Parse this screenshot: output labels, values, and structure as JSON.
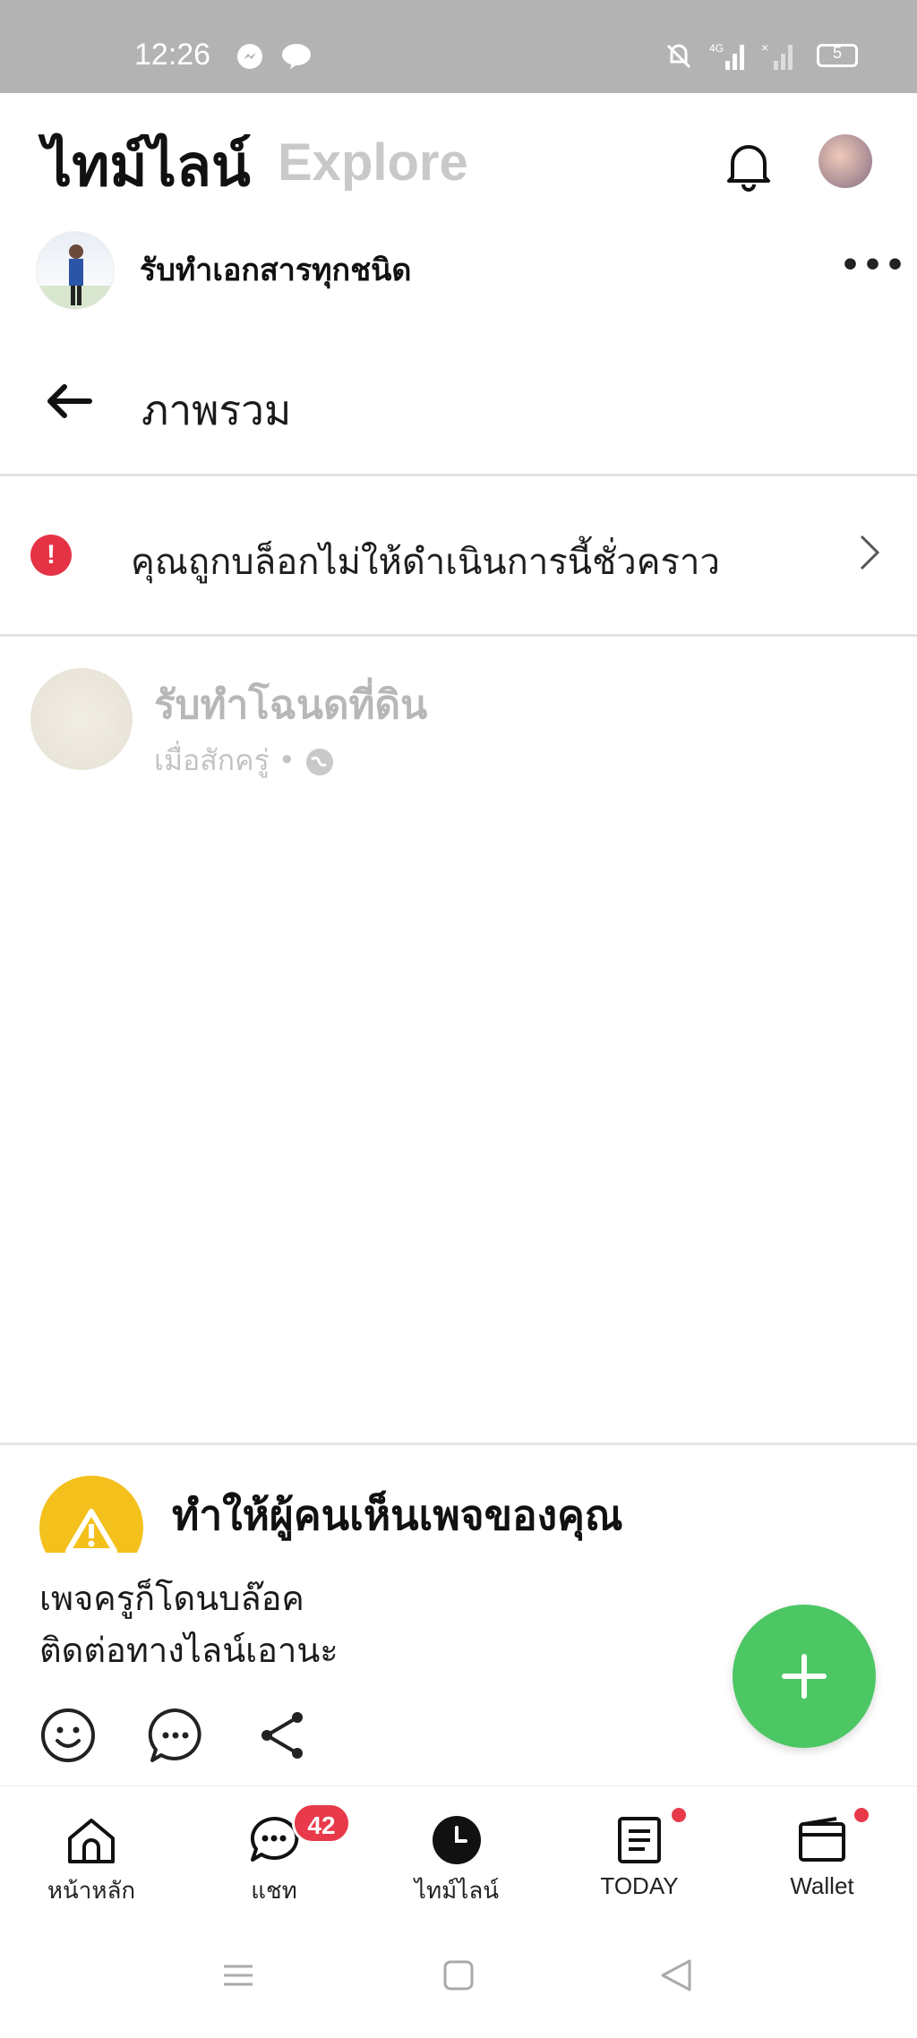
{
  "status_bar": {
    "time": "12:26",
    "network": "4G",
    "battery": "5",
    "bg_color": "#b3b3b3"
  },
  "header": {
    "title": "ไทม์ไลน์",
    "explore": "Explore",
    "bell_icon": "bell-icon"
  },
  "post": {
    "author": "รับทำเอกสารทุกชนิด",
    "embed": {
      "overview_label": "ภาพรวม",
      "blocked_message": "คุณถูกบล็อกไม่ให้ดำเนินการนี้ชั่วคราว",
      "faded_title": "รับทำโฉนดที่ดิน",
      "faded_sub": "เมื่อสักครู่ •"
    },
    "promo_title": "ทำให้ผู้คนเห็นเพจของคุณ",
    "caption_line1": "เพจครูก็โดนบล๊อค",
    "caption_line2": "ติดต่อทางไลน์เอานะ"
  },
  "tabs": [
    {
      "label": "หน้าหลัก",
      "icon": "home-icon"
    },
    {
      "label": "แชท",
      "icon": "chat-icon",
      "badge": "42"
    },
    {
      "label": "ไทม์ไลน์",
      "icon": "timeline-icon"
    },
    {
      "label": "TODAY",
      "icon": "today-icon"
    },
    {
      "label": "Wallet",
      "icon": "wallet-icon"
    }
  ],
  "colors": {
    "accent_green": "#4cc764",
    "alert_red": "#e53345",
    "badge_red": "#e83a4a",
    "warning_yellow": "#f4c01c"
  }
}
